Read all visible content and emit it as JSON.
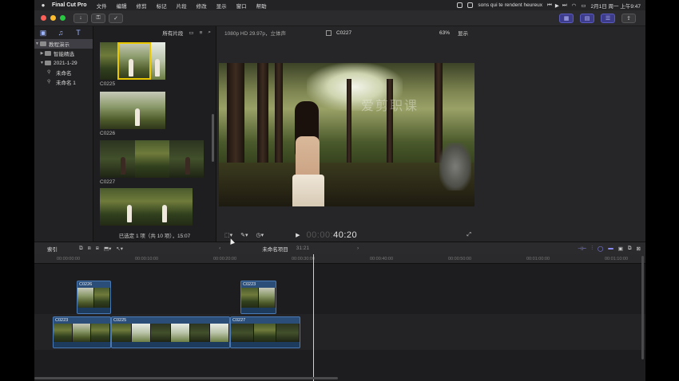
{
  "menubar": {
    "app_name": "Final Cut Pro",
    "items": [
      "文件",
      "编辑",
      "修剪",
      "标记",
      "片段",
      "修改",
      "显示",
      "窗口",
      "帮助"
    ],
    "now_playing": "sons qui te rendent heureux",
    "clock": "2月1日 周一 上午9:47"
  },
  "toolbar": {
    "import_icon": "download-icon",
    "keywords_icon": "key-icon",
    "check_icon": "check-icon"
  },
  "sidebar": {
    "items": [
      {
        "label": "教程演示",
        "level": 0
      },
      {
        "label": "智能精选",
        "level": 1
      },
      {
        "label": "2021-1-29",
        "level": 1
      },
      {
        "label": "未命名",
        "level": 2
      },
      {
        "label": "未命名 1",
        "level": 2
      }
    ]
  },
  "browser": {
    "filter": "所有片段",
    "clips": [
      {
        "name": "C0225"
      },
      {
        "name": "C0226"
      },
      {
        "name": "C0227"
      }
    ],
    "status": "已选定 1 项（共 10 项），15:07"
  },
  "viewer": {
    "format": "1080p HD 29.97p，立体声",
    "clip_name": "C0227",
    "zoom": "63%",
    "display": "显示",
    "watermark": "爱剪职课",
    "timecode_dim": "00:00:",
    "timecode": "40:20"
  },
  "timeline": {
    "index_label": "索引",
    "project_name": "未命名项目",
    "duration": "31:21",
    "ruler_labels": [
      "00:00:00:00",
      "00:00:10:00",
      "00:00:20:00",
      "00:00:30:00",
      "00:00:40:00",
      "00:00:50:00",
      "00:01:00:00",
      "00:01:10:00"
    ],
    "clips": {
      "upper_1": "C0226",
      "upper_2": "C0223",
      "main_1": "C0223",
      "main_2": "C0225",
      "main_3": "C0227"
    }
  }
}
